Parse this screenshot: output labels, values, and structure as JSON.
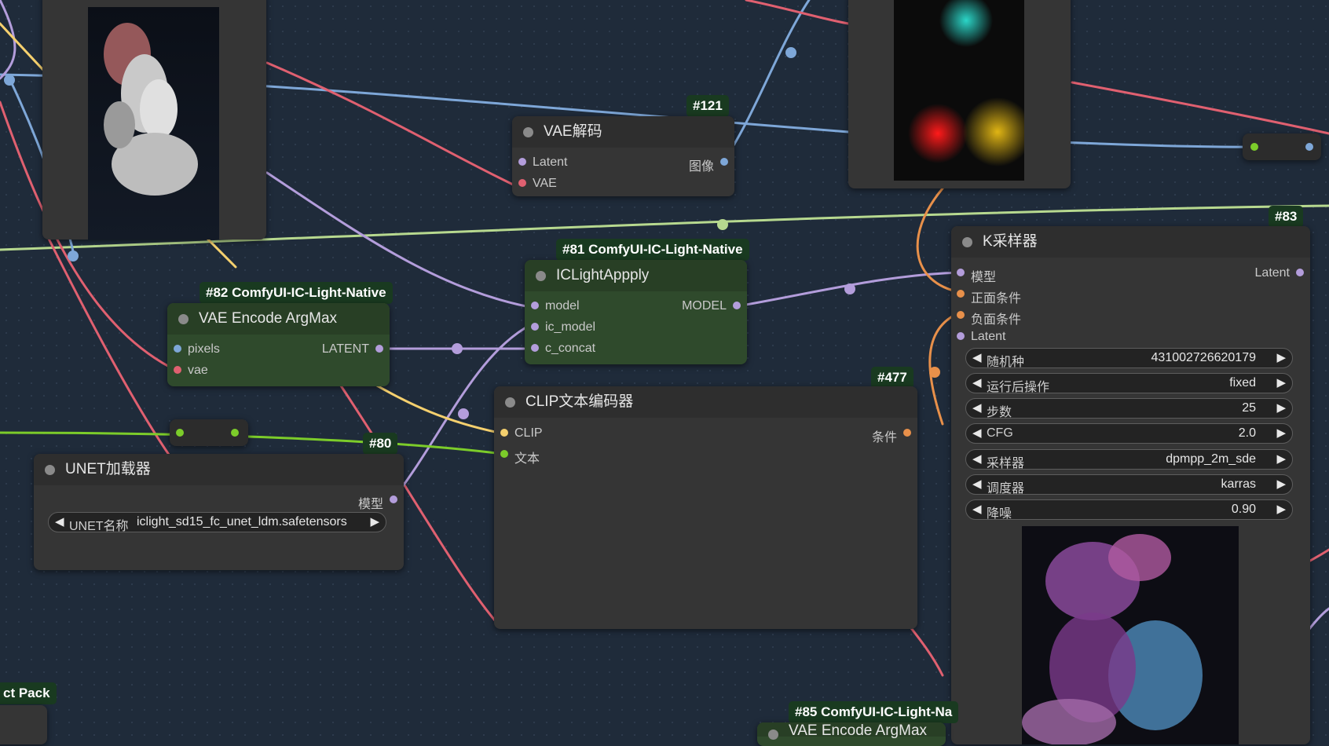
{
  "colors": {
    "canvas_bg": "#1f2b3a",
    "node_bg": "#353535",
    "node_green_bg": "#2f4a2c",
    "badge_bg": "#193a20",
    "wire_model": "#b39ddb",
    "wire_vae": "#e06070",
    "wire_clip": "#f5d06e",
    "wire_conditioning": "#e8904a",
    "wire_image": "#7ea7d8",
    "wire_text": "#7ccc2a",
    "wire_latent_main": "#b7d98f"
  },
  "nodes": {
    "vae_decode": {
      "badge": "#121",
      "title": "VAE解码",
      "inputs": [
        "Latent",
        "VAE"
      ],
      "output": "图像"
    },
    "iclight_apply": {
      "badge": "#81 ComfyUI-IC-Light-Native",
      "title": "ICLightAppply",
      "inputs": [
        "model",
        "ic_model",
        "c_concat"
      ],
      "output": "MODEL"
    },
    "vae_encode_argmax": {
      "badge": "#82 ComfyUI-IC-Light-Native",
      "title": "VAE Encode ArgMax",
      "inputs": [
        "pixels",
        "vae"
      ],
      "output": "LATENT"
    },
    "unet_loader": {
      "badge": "#80",
      "title": "UNET加载器",
      "output": "模型",
      "widget_label": "UNET名称",
      "widget_value": "iclight_sd15_fc_unet_ldm.safetensors"
    },
    "clip_text_encode": {
      "badge": "#477",
      "title": "CLIP文本编码器",
      "inputs": [
        "CLIP",
        "文本"
      ],
      "output": "条件"
    },
    "ksampler": {
      "badge": "#83",
      "title": "K采样器",
      "inputs": [
        "模型",
        "正面条件",
        "负面条件",
        "Latent"
      ],
      "output": "Latent",
      "widgets": [
        {
          "label": "随机种",
          "value": "431002726620179"
        },
        {
          "label": "运行后操作",
          "value": "fixed"
        },
        {
          "label": "步数",
          "value": "25"
        },
        {
          "label": "CFG",
          "value": "2.0"
        },
        {
          "label": "采样器",
          "value": "dpmpp_2m_sde"
        },
        {
          "label": "调度器",
          "value": "karras"
        },
        {
          "label": "降噪",
          "value": "0.90"
        }
      ]
    },
    "partial_left": {
      "badge": "ct Pack"
    },
    "partial_bottom": {
      "badge": "#85 ComfyUI-IC-Light-Na",
      "title": "VAE Encode ArgMax"
    }
  }
}
